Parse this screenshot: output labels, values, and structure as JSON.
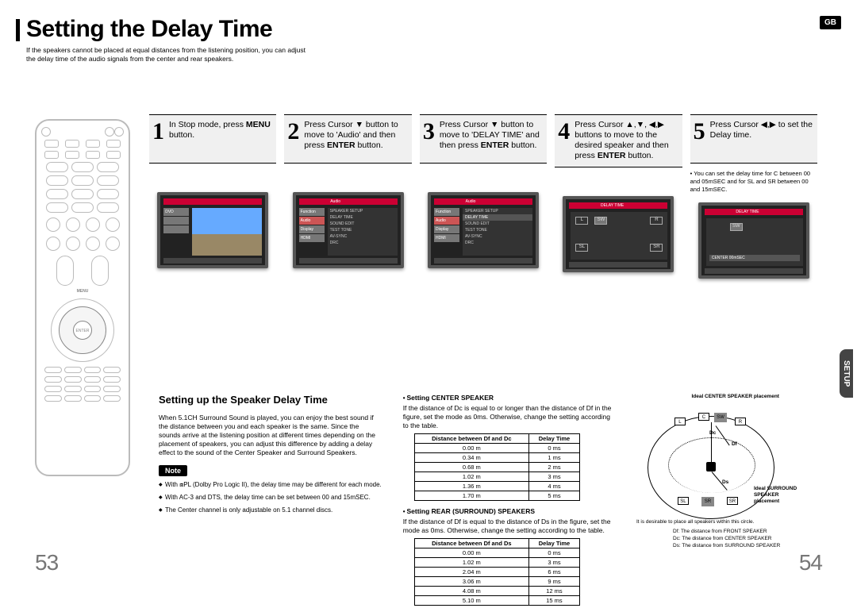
{
  "header": {
    "title": "Setting the Delay Time",
    "intro": "If the speakers cannot be placed at equal distances from the listening position, you can adjust the delay time of the audio signals from the center and rear speakers.",
    "badge": "GB",
    "side_tab": "SETUP"
  },
  "steps": [
    {
      "num": "1",
      "html": "In Stop mode, press <b>MENU</b> button."
    },
    {
      "num": "2",
      "html": "Press Cursor ▼ button to move to 'Audio' and then press <b>ENTER</b> button."
    },
    {
      "num": "3",
      "html": "Press Cursor ▼ button to move to 'DELAY TIME' and then press <b>ENTER</b> button."
    },
    {
      "num": "4",
      "html": "Press Cursor ▲,▼, ◀,▶ buttons to move to the desired speaker and then press <b>ENTER</b> button."
    },
    {
      "num": "5",
      "html": "Press Cursor ◀,▶ to set the Delay time."
    }
  ],
  "step5_note": "You can set the delay time for C between 00 and 05mSEC and for SL and SR between 00 and 15mSEC.",
  "osd": {
    "menus": [
      "Function",
      "Audio",
      "Display",
      "HDMI"
    ],
    "audio_items": [
      "SPEAKER SETUP",
      "DELAY TIME",
      "SOUND EDIT",
      "TEST TONE",
      "AV-SYNC",
      "DRC"
    ],
    "delay_title": "DELAY TIME",
    "center_val": "CENTER       00mSEC"
  },
  "section": {
    "heading": "Setting up the Speaker Delay Time",
    "para": "When 5.1CH Surround Sound is played, you can enjoy the best sound if the distance between you and each speaker is the same. Since the sounds arrive at the listening position at different times depending on the placement of speakers, you can adjust this difference by adding a delay effect to the sound of the Center Speaker and Surround Speakers.",
    "note_label": "Note",
    "bullets": [
      "With ⧈PL (Dolby Pro Logic II), the delay time may be different for each mode.",
      "With AC-3 and DTS, the delay time can be set between 00 and 15mSEC.",
      "The Center channel is only adjustable on 5.1 channel discs."
    ]
  },
  "center_speaker": {
    "heading": "Setting CENTER SPEAKER",
    "para": "If the distance of Dc is equal to or longer than the distance of Df in the figure, set the mode as 0ms. Otherwise, change the setting according to the table.",
    "th1": "Distance between Df and Dc",
    "th2": "Delay Time",
    "rows": [
      [
        "0.00 m",
        "0 ms"
      ],
      [
        "0.34 m",
        "1 ms"
      ],
      [
        "0.68 m",
        "2 ms"
      ],
      [
        "1.02 m",
        "3 ms"
      ],
      [
        "1.36 m",
        "4 ms"
      ],
      [
        "1.70 m",
        "5 ms"
      ]
    ]
  },
  "rear_speaker": {
    "heading": "Setting REAR (SURROUND) SPEAKERS",
    "para": "If the distance of Df is equal to the distance of Ds in the figure, set the mode as 0ms. Otherwise, change the setting according to the table.",
    "th1": "Distance between Df and Ds",
    "th2": "Delay Time",
    "rows": [
      [
        "0.00 m",
        "0 ms"
      ],
      [
        "1.02 m",
        "3 ms"
      ],
      [
        "2.04 m",
        "6 ms"
      ],
      [
        "3.06 m",
        "9 ms"
      ],
      [
        "4.08 m",
        "12 ms"
      ],
      [
        "5.10 m",
        "15 ms"
      ]
    ]
  },
  "diagram": {
    "ideal_center": "Ideal CENTER SPEAKER placement",
    "ideal_surround": "Ideal SURROUND SPEAKER placement",
    "circle_note": "It is desirable to place all speakers within this circle.",
    "legend": [
      "Df: The distance from FRONT SPEAKER",
      "Dc: The distance from CENTER SPEAKER",
      "Ds: The distance from SURROUND SPEAKER"
    ],
    "labels": {
      "L": "L",
      "C": "C",
      "SW": "SW",
      "R": "R",
      "Dc": "Dc",
      "Df": "Df",
      "Ds": "Ds",
      "SL": "SL",
      "SR": "SR"
    }
  },
  "pages": {
    "left": "53",
    "right": "54"
  }
}
